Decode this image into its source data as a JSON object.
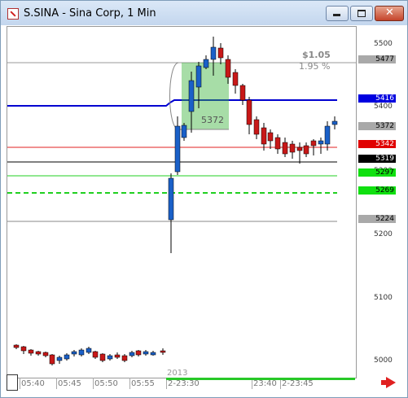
{
  "window": {
    "title": "S.SINA - Sina Corp, 1 Min"
  },
  "chart": {
    "y_ticks": [
      "5500",
      "5400",
      "5300",
      "5200",
      "5100",
      "5000"
    ],
    "price_labels": [
      {
        "text": "5477",
        "bg": "#a9a9a9",
        "fg": "#000000",
        "value": 5477
      },
      {
        "text": "5416",
        "bg": "#0000e0",
        "fg": "#ffffff",
        "value": 5416
      },
      {
        "text": "5372",
        "bg": "#a9a9a9",
        "fg": "#000000",
        "value": 5372
      },
      {
        "text": "5342",
        "bg": "#e00000",
        "fg": "#ffffff",
        "value": 5342
      },
      {
        "text": "5319",
        "bg": "#000000",
        "fg": "#ffffff",
        "value": 5319
      },
      {
        "text": "5297",
        "bg": "#10e010",
        "fg": "#000000",
        "value": 5297
      },
      {
        "text": "5269",
        "bg": "#10e010",
        "fg": "#000000",
        "value": 5269
      },
      {
        "text": "5224",
        "bg": "#a9a9a9",
        "fg": "#000000",
        "value": 5224
      }
    ],
    "measure": {
      "change": "$1.05",
      "percent": "1.95 %",
      "level": "5372"
    },
    "time_labels": [
      "05:40",
      "05:45",
      "05:50",
      "05:55",
      "2-23:30",
      "23:40",
      "2-23:45"
    ],
    "year": "2013",
    "colors": {
      "up": "#1a60c8",
      "down": "#c81818",
      "bluefill": "#0000e0"
    }
  }
}
